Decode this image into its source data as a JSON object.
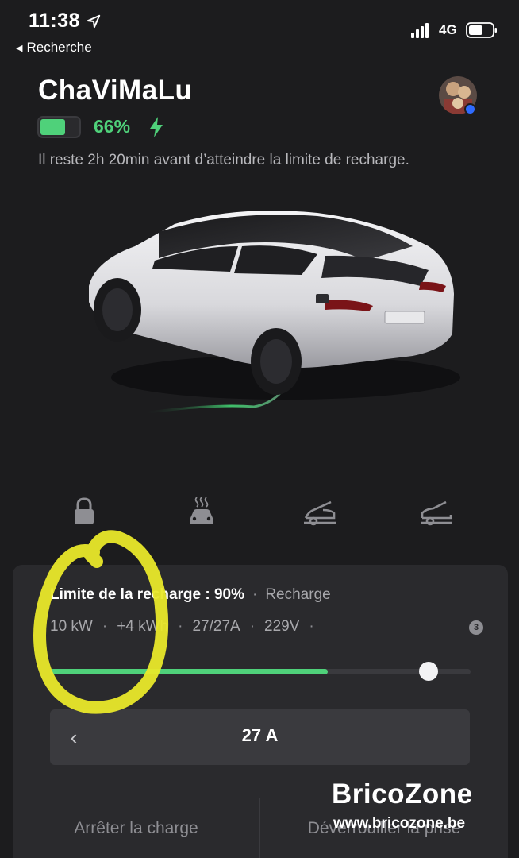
{
  "status_bar": {
    "time": "11:38",
    "back_label": "Recherche",
    "network": "4G"
  },
  "vehicle": {
    "name": "ChaViMaLu",
    "battery_percent_label": "66%",
    "battery_level": 0.66,
    "charging": true,
    "status_text": "Il reste 2h 20min avant d’atteindre la limite de recharge."
  },
  "controls": [
    {
      "name": "lock",
      "icon": "lock-icon"
    },
    {
      "name": "climate",
      "icon": "climate-icon"
    },
    {
      "name": "frunk",
      "icon": "frunk-icon"
    },
    {
      "name": "trunk",
      "icon": "trunk-icon"
    }
  ],
  "charging_card": {
    "limit_label": "Limite de la recharge : 90%",
    "state_label": "Recharge",
    "stats": [
      "10 kW",
      "+4 kWh",
      "27/27A",
      "229V"
    ],
    "info_badge": "3",
    "slider_fill_fraction": 0.66,
    "slider_thumb_fraction": 0.9,
    "amperage_value": "27 A",
    "stop_button_label": "Arrêter la charge",
    "unlock_button_label": "Déverrouiller la prise"
  },
  "watermark": {
    "title": "BricoZone",
    "url": "www.bricozone.be"
  },
  "colors": {
    "background": "#1c1c1e",
    "accent_green": "#4fd17a",
    "card": "#2a2a2d",
    "highlight_yellow": "#e9e82a"
  }
}
